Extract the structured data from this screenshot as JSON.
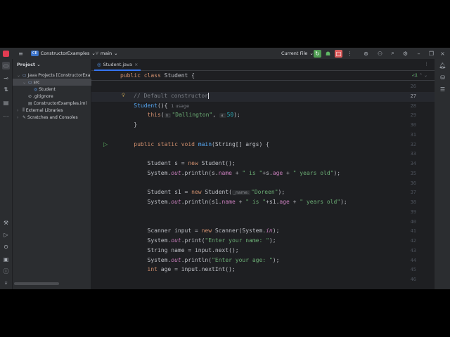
{
  "titlebar": {
    "project_badge": "CE",
    "project_name": "ConstructorExamples",
    "branch": "main",
    "run_config": "Current File"
  },
  "project_panel": {
    "title": "Project",
    "tree": [
      {
        "label": "Java Projects [ConstructorExa",
        "indent": 1,
        "icon": "folder",
        "arrow": "v"
      },
      {
        "label": "src",
        "indent": 2,
        "icon": "folder",
        "arrow": "v",
        "selected": true
      },
      {
        "label": "Student",
        "indent": 3,
        "icon": "class"
      },
      {
        "label": ".gitignore",
        "indent": 2,
        "icon": "ignore"
      },
      {
        "label": "ConstructorExamples.iml",
        "indent": 2,
        "icon": "file"
      },
      {
        "label": "External Libraries",
        "indent": 1,
        "icon": "library",
        "arrow": ">"
      },
      {
        "label": "Scratches and Consoles",
        "indent": 1,
        "icon": "scratch",
        "arrow": ">"
      }
    ]
  },
  "editor": {
    "tab_label": "Student.java",
    "sticky_line": "4",
    "sticky_code": [
      [
        "k",
        "public class "
      ],
      [
        "",
        "Student {"
      ]
    ],
    "inspection": "✓1",
    "lines": [
      {
        "n": "26",
        "t": []
      },
      {
        "n": "27",
        "t": [
          [
            "c",
            "// Default constructor"
          ]
        ],
        "current": true,
        "bulb": true
      },
      {
        "n": "28",
        "t": [
          [
            "",
            "    "
          ],
          [
            "m",
            "Student"
          ],
          [
            "",
            "(){ "
          ],
          [
            "hint",
            "1 usage"
          ]
        ]
      },
      {
        "n": "29",
        "t": [
          [
            "",
            "        "
          ],
          [
            "k",
            "this"
          ],
          [
            "",
            "("
          ],
          [
            "h",
            "n:"
          ],
          [
            "s",
            "\"Dallington\""
          ],
          [
            "",
            ", "
          ],
          [
            "h",
            "a:"
          ],
          [
            "n",
            "50"
          ],
          [
            "",
            ");"
          ]
        ]
      },
      {
        "n": "30",
        "t": [
          [
            "",
            "    }"
          ]
        ]
      },
      {
        "n": "31",
        "t": []
      },
      {
        "n": "32",
        "t": [
          [
            "",
            "    "
          ],
          [
            "k",
            "public static void "
          ],
          [
            "m",
            "main"
          ],
          [
            "",
            "(String[] args) {"
          ]
        ],
        "run": true
      },
      {
        "n": "33",
        "t": []
      },
      {
        "n": "34",
        "t": [
          [
            "",
            "        Student s = "
          ],
          [
            "k",
            "new "
          ],
          [
            "",
            "Student();"
          ]
        ]
      },
      {
        "n": "35",
        "t": [
          [
            "",
            "        System."
          ],
          [
            "st",
            "out"
          ],
          [
            "",
            ".println(s."
          ],
          [
            "f",
            "name"
          ],
          [
            "",
            " + "
          ],
          [
            "s",
            "\" is \""
          ],
          [
            "",
            "+s."
          ],
          [
            "f",
            "age"
          ],
          [
            "",
            " + "
          ],
          [
            "s",
            "\" years old\""
          ],
          [
            "",
            ");"
          ]
        ]
      },
      {
        "n": "36",
        "t": []
      },
      {
        "n": "37",
        "t": [
          [
            "",
            "        Student s1 = "
          ],
          [
            "k",
            "new "
          ],
          [
            "",
            "Student("
          ],
          [
            "h",
            "_name:"
          ],
          [
            "s",
            "\"Doreen\""
          ],
          [
            "",
            ");"
          ]
        ]
      },
      {
        "n": "38",
        "t": [
          [
            "",
            "        System."
          ],
          [
            "st",
            "out"
          ],
          [
            "",
            ".println(s1."
          ],
          [
            "f",
            "name"
          ],
          [
            "",
            " + "
          ],
          [
            "s",
            "\" is \""
          ],
          [
            "",
            "+s1."
          ],
          [
            "f",
            "age"
          ],
          [
            "",
            " + "
          ],
          [
            "s",
            "\" years old\""
          ],
          [
            "",
            ");"
          ]
        ]
      },
      {
        "n": "39",
        "t": []
      },
      {
        "n": "40",
        "t": []
      },
      {
        "n": "41",
        "t": [
          [
            "",
            "        Scanner input = "
          ],
          [
            "k",
            "new "
          ],
          [
            "",
            "Scanner(System."
          ],
          [
            "st",
            "in"
          ],
          [
            "",
            ");"
          ]
        ]
      },
      {
        "n": "42",
        "t": [
          [
            "",
            "        System."
          ],
          [
            "st",
            "out"
          ],
          [
            "",
            ".print("
          ],
          [
            "s",
            "\"Enter your name: \""
          ],
          [
            "",
            ");"
          ]
        ]
      },
      {
        "n": "43",
        "t": [
          [
            "",
            "        String name = input.next();"
          ]
        ]
      },
      {
        "n": "44",
        "t": [
          [
            "",
            "        System."
          ],
          [
            "st",
            "out"
          ],
          [
            "",
            ".println("
          ],
          [
            "s",
            "\"Enter your age: \""
          ],
          [
            "",
            ");"
          ]
        ]
      },
      {
        "n": "45",
        "t": [
          [
            "",
            "        "
          ],
          [
            "k",
            "int "
          ],
          [
            "",
            "age = input.nextInt();"
          ]
        ]
      },
      {
        "n": "46",
        "t": []
      }
    ]
  }
}
